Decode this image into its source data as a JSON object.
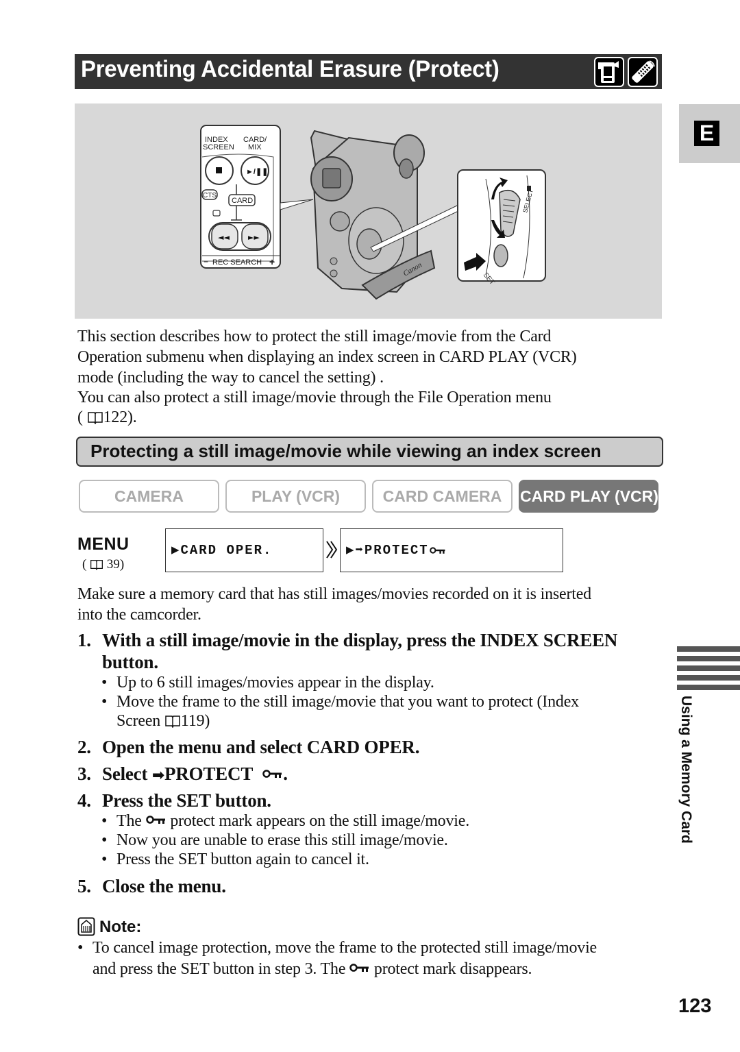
{
  "header": {
    "title": "Preventing Accidental Erasure (Protect)",
    "icons": [
      "camcorder-icon",
      "remote-control-icon"
    ]
  },
  "side_tab": {
    "letter": "E",
    "section_label": "Using a Memory Card"
  },
  "illustration": {
    "panel_labels": {
      "index_screen": "INDEX SCREEN",
      "index_screen_line1": "INDEX",
      "index_screen_line2": "SCREEN",
      "card_mix_line1": "CARD/",
      "card_mix_line2": "MIX",
      "effects_partial": "CTS",
      "card": "CARD",
      "rec_search": "REC SEARCH",
      "rec_minus": "−",
      "rec_plus": "+"
    },
    "dial_labels": {
      "select": "SELECT",
      "set": "SET"
    },
    "brand": "Canon"
  },
  "intro": {
    "lines": [
      "This section describes how to protect the still image/movie from the Card",
      "Operation submenu when displaying an index screen in CARD PLAY (VCR)",
      "mode (including the way to cancel the setting) .",
      "You can also protect a still image/movie through the File Operation menu"
    ],
    "ref_open": "(",
    "ref_page": "122).",
    "ref_icon": "book-icon"
  },
  "subheading": "Protecting a still image/movie while viewing an index screen",
  "modes": [
    {
      "label": "CAMERA",
      "active": false
    },
    {
      "label": "PLAY (VCR)",
      "active": false
    },
    {
      "label": "CARD CAMERA",
      "active": false
    },
    {
      "label": "CARD PLAY (VCR)",
      "active": true
    }
  ],
  "menu": {
    "label": "MENU",
    "ref_open": "(",
    "ref_page": "39)",
    "items": [
      "▶CARD OPER.",
      "▶➡PROTECT"
    ]
  },
  "prerequisite": {
    "lines": [
      "Make sure a memory card that has still images/movies recorded on it is inserted",
      "into the camcorder."
    ]
  },
  "steps": [
    {
      "num": "1.",
      "lines": [
        "With a still image/movie in the display, press the INDEX SCREEN",
        "button."
      ],
      "bullets": [
        [
          "Up to 6 still images/movies appear in the display."
        ],
        [
          "Move the frame to the still image/movie that you want to protect (Index",
          "Screen",
          "119)"
        ]
      ]
    },
    {
      "num": "2.",
      "lines": [
        "Open the menu and select CARD OPER."
      ]
    },
    {
      "num": "3.",
      "pre": "Select ",
      "arrow": "➡",
      "text": "PROTECT",
      "post": "."
    },
    {
      "num": "4.",
      "lines": [
        "Press the SET button."
      ],
      "bullets": [
        [
          "The",
          "protect mark appears on the still image/movie."
        ],
        [
          "Now you are unable to erase this still image/movie."
        ],
        [
          "Press the SET button again to cancel it."
        ]
      ]
    },
    {
      "num": "5.",
      "lines": [
        "Close the menu."
      ]
    }
  ],
  "note": {
    "heading": "Note:",
    "lines": [
      "To cancel image protection, move the frame to the protected still image/movie",
      "and press the SET button in step 3. The",
      "protect mark disappears."
    ]
  },
  "page_number": "123",
  "bullet_char": "•"
}
